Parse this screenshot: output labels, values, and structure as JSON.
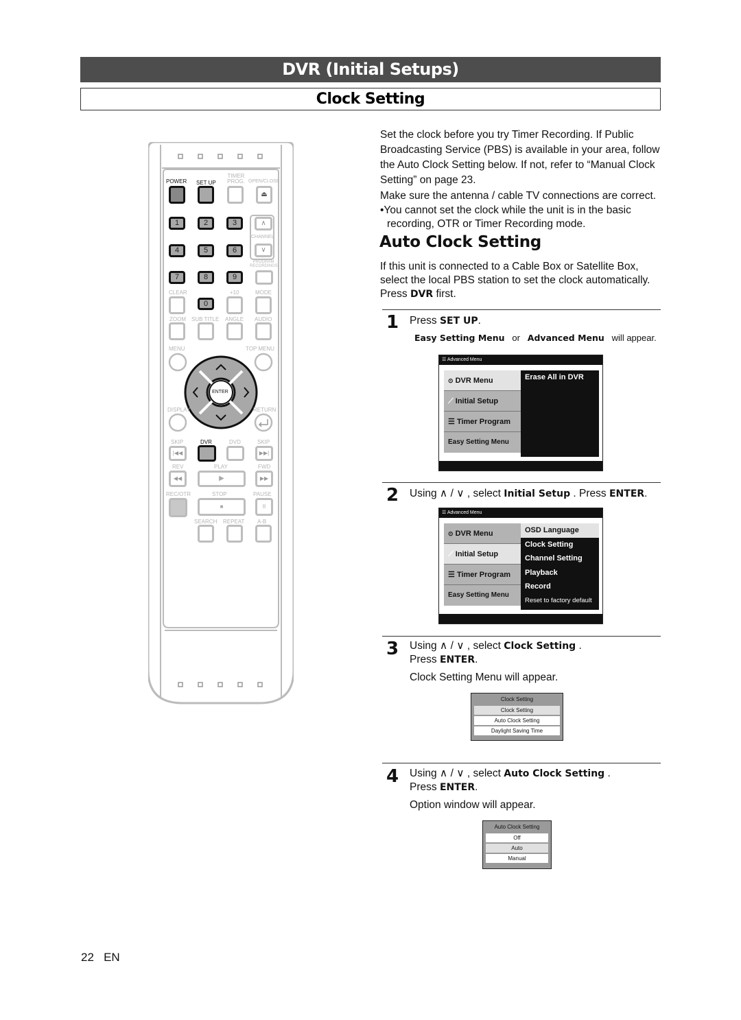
{
  "header": {
    "section_title": "DVR (Initial Setups)",
    "page_title": "Clock Setting"
  },
  "remote": {
    "top_labels": {
      "power": "POWER",
      "setup": "SET UP",
      "timer": "TIMER PROG.",
      "openclose": "OPEN/CLOSE",
      "channel": "CHANNEL",
      "program": "PROGRAM RECORDINGS"
    },
    "numbers": [
      "1",
      "2",
      "3",
      "4",
      "5",
      "6",
      "7",
      "8",
      "9",
      "0"
    ],
    "labels": {
      "clear": "CLEAR",
      "plus10": "+10",
      "mode": "MODE",
      "zoom": "ZOOM",
      "subtitle": "SUB TITLE",
      "angle": "ANGLE",
      "audio": "AUDIO",
      "menu": "MENU",
      "topmenu": "TOP MENU",
      "enter": "ENTER",
      "display": "DISPLAY",
      "return": "RETURN",
      "skip_l": "SKIP",
      "dvr": "DVR",
      "dvd": "DVD",
      "skip_r": "SKIP",
      "rev": "REV",
      "play": "PLAY",
      "fwd": "FWD",
      "recotr": "REC/OTR",
      "stop": "STOP",
      "pause": "PAUSE",
      "search": "SEARCH",
      "repeat": "REPEAT",
      "ab": "A-B"
    }
  },
  "intro": {
    "line1": "Set the clock before you try Timer Recording.  If Public",
    "line2": "Broadcasting Service (PBS) is available in your area, follow",
    "line3": "the Auto Clock Setting below.  If not, refer to “Manual Clock",
    "line4": "Setting” on page 23.",
    "line5": "Make sure the antenna / cable TV connections are correct.",
    "note_a": "•You cannot set the clock while the unit is in the basic",
    "note_b": "recording, OTR or Timer Recording mode."
  },
  "auto": {
    "heading": "Auto Clock Setting",
    "p1": "If this unit is connected to a Cable Box or Satellite Box,",
    "p2": "select the local PBS station to set the clock automatically.",
    "p3_pre": "Press ",
    "p3_bold": "DVR",
    "p3_post": " first."
  },
  "steps": [
    {
      "num": "1",
      "pre": "Press ",
      "bold": "SET UP",
      "post": ".",
      "sub_b1": "Easy Setting Menu",
      "sub_or": "or",
      "sub_b2": "Advanced Menu",
      "sub_post": "will appear."
    },
    {
      "num": "2",
      "pre": "Using ∧ / ∨ , select ",
      "bold": "Initial Setup",
      "post": " . Press ",
      "bold2": "ENTER",
      "post2": "."
    },
    {
      "num": "3",
      "pre": "Using ∧ / ∨ , select ",
      "bold": "Clock Setting",
      "post": " .",
      "line2_pre": "Press ",
      "line2_bold": "ENTER",
      "line2_post": ".",
      "note": "Clock Setting Menu will appear."
    },
    {
      "num": "4",
      "pre": "Using ∧ / ∨ , select ",
      "bold": "Auto Clock Setting",
      "post": " .",
      "line2_pre": "Press ",
      "line2_bold": "ENTER",
      "line2_post": ".",
      "note": "Option window will appear."
    }
  ],
  "osd1": {
    "title": "Advanced Menu",
    "left": [
      "DVR Menu",
      "Initial Setup",
      "Timer Program",
      "Easy Setting Menu"
    ],
    "right": [
      "Erase All in DVR"
    ]
  },
  "osd2": {
    "title": "Advanced Menu",
    "left": [
      "DVR Menu",
      "Initial Setup",
      "Timer Program",
      "Easy Setting Menu"
    ],
    "right": [
      "OSD Language",
      "Clock Setting",
      "Channel Setting",
      "Playback",
      "Record",
      "Reset to factory default"
    ]
  },
  "popup1": {
    "title": "Clock Setting",
    "options": [
      "Clock Setting",
      "Auto Clock Setting",
      "Daylight Saving Time"
    ]
  },
  "popup2": {
    "title": "Auto Clock Setting",
    "options": [
      "Off",
      "Auto",
      "Manual"
    ]
  },
  "footer": {
    "page": "22",
    "lang": "EN"
  }
}
